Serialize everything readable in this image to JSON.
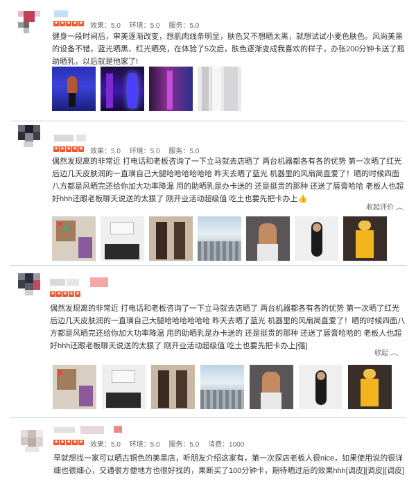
{
  "reviews": [
    {
      "scores": {
        "effect": "效果：5.0",
        "env": "环境：5.0",
        "service": "服务：5.0",
        "price": ""
      },
      "text": "健身一段时间后，审美逐渐改变，想肌肉线条明显，肤色又不想晒太黑，就想试试小麦色肤色。风尚美黑的设备不错，蓝光晒黑、红光晒亮，在体验了5次后，肤色逐渐变成我喜欢的样子，办张200分钟卡送了瓶助晒乳，以后就是他家了!",
      "collapse": "",
      "photos": [
        "blue-light-room",
        "blue-tanning-bed",
        "hallway-purple",
        "locker-room"
      ]
    },
    {
      "scores": {
        "effect": "效果：5.0",
        "env": "环境：5.0",
        "service": "服务：5.0",
        "price": ""
      },
      "text": "偶然发现离的非常近 打电话和老板咨询了一下立马就去店晒了 两台机器都各有各的优势 第一次晒了红光 后边几天皮肤润的一直璜自己大腿哈哈哈哈哈哈 昨天去晒了蓝光 机器里的风扇简直爱了！晒的时候四面八方都是风晒完还给你加大功率降温 用的助晒乳是办卡送的 还是挺贵的那种 还送了唇膏哈哈 老板人也超好hhh还跟老板聊天说送的太狠了 刚开业活动超级值 吃土也要先把卡办上👍",
      "collapse": "收起评价",
      "photos": [
        "photo-wall-room",
        "reception-desk",
        "corridor-doors",
        "city-view",
        "back-pose",
        "phone-selfie",
        "yellow-outfit"
      ]
    },
    {
      "scores": {
        "effect": "效果：5.0",
        "env": "环境：5.0",
        "service": "服务：5.0",
        "price": ""
      },
      "text": "偶然发现离的非常近 打电话和老板咨询了一下立马就去店晒了 两台机器都各有各的优势 第一次晒了红光 后边几天皮肤润的一直璜自己大腿哈哈哈哈哈哈 昨天去晒了蓝光 机器里的风扇简直爱了！晒的时候四面八方都是风晒完还给你加大功率降温 用的助晒乳是办卡送的 还是挺贵的那种 还送了唇膏哈哈的 老板人也超好hhh还跟老板聊天说送的太狠了 刚开业活动超级值 吃土也要先把卡办上[强]",
      "collapse": "收起",
      "photos": [
        "photo-wall-room",
        "reception-desk",
        "corridor-doors",
        "city-view",
        "back-pose",
        "phone-selfie",
        "yellow-outfit"
      ]
    },
    {
      "scores": {
        "effect": "效果：5.0",
        "env": "环境：5.0",
        "service": "服务：5.0",
        "price": "消费：1000"
      },
      "text": "早就想找一家可以晒古铜色的美黑店，听朋友介绍这家有，第一次探店老板人很nice，如果使用说的很详细也很细心，交通很方便地方也很好找的，果断买了100分钟卡，期待晒过后的效果hhh[调皮][调皮][调皮]",
      "collapse": "",
      "photos": []
    }
  ],
  "colors": {
    "star": "#f2552c",
    "divider": "#b9cfe8",
    "link": "#666666"
  }
}
